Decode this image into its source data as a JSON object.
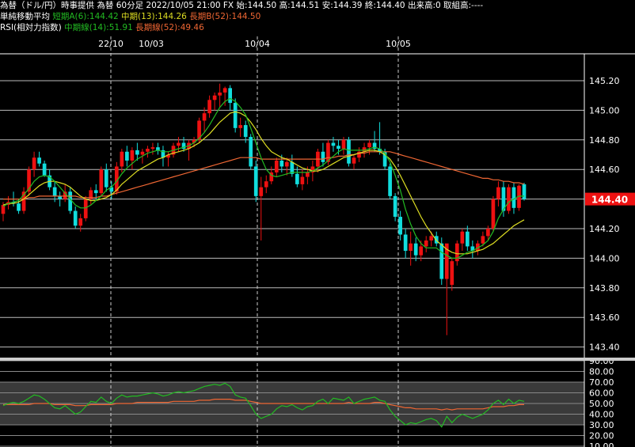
{
  "header": {
    "line1": {
      "title": "為替（ドル/円）時事提供 為替 60分足 2022/10/05 21:00 FX",
      "open": "始:144.50",
      "high": "高:144.51",
      "low": "安:144.39",
      "close": "終:144.40",
      "volume": "出来高:0 取組高:----"
    },
    "line2": {
      "label": "単純移動平均",
      "short": "短期A(6):144.42",
      "mid": "中期(13):144.26",
      "long": "長期B(52):144.50"
    },
    "line3": {
      "label": "RSI(相対力指数)",
      "mid": "中期線(14):51.91",
      "long": "長期線(52):49.46"
    }
  },
  "colors": {
    "up": "#ee1111",
    "down": "#11dddd",
    "ma_short": "#22bb22",
    "ma_mid": "#dddd22",
    "ma_long": "#ee6633",
    "rsi_mid": "#22bb22",
    "rsi_long": "#ee6633",
    "price_tag": "#ee1111"
  },
  "price_tag": "144.40",
  "chart_data": [
    {
      "type": "candlestick",
      "title": "為替（ドル/円）時事提供 為替 60分足",
      "date_labels": [
        "22/10",
        "10/03",
        "10/04",
        "10/05"
      ],
      "ylim": [
        143.3,
        145.3
      ],
      "yticks": [
        "145.20",
        "145.00",
        "144.80",
        "144.60",
        "144.40",
        "144.20",
        "144.00",
        "143.80",
        "143.60",
        "143.40"
      ],
      "candles": [
        [
          144.3,
          144.38,
          144.25,
          144.36
        ],
        [
          144.36,
          144.42,
          144.33,
          144.38
        ],
        [
          144.38,
          144.45,
          144.35,
          144.37
        ],
        [
          144.37,
          144.4,
          144.3,
          144.32
        ],
        [
          144.32,
          144.48,
          144.3,
          144.45
        ],
        [
          144.45,
          144.62,
          144.42,
          144.6
        ],
        [
          144.6,
          144.72,
          144.55,
          144.68
        ],
        [
          144.68,
          144.72,
          144.62,
          144.64
        ],
        [
          144.64,
          144.66,
          144.55,
          144.56
        ],
        [
          144.56,
          144.6,
          144.46,
          144.48
        ],
        [
          144.48,
          144.52,
          144.38,
          144.42
        ],
        [
          144.42,
          144.45,
          144.35,
          144.4
        ],
        [
          144.4,
          144.5,
          144.38,
          144.45
        ],
        [
          144.45,
          144.48,
          144.3,
          144.32
        ],
        [
          144.32,
          144.35,
          144.2,
          144.22
        ],
        [
          144.22,
          144.3,
          144.18,
          144.27
        ],
        [
          144.27,
          144.42,
          144.25,
          144.4
        ],
        [
          144.4,
          144.48,
          144.36,
          144.46
        ],
        [
          144.46,
          144.5,
          144.4,
          144.44
        ],
        [
          144.44,
          144.62,
          144.42,
          144.6
        ],
        [
          144.6,
          144.64,
          144.45,
          144.48
        ],
        [
          144.48,
          144.52,
          144.4,
          144.45
        ],
        [
          144.45,
          144.65,
          144.43,
          144.62
        ],
        [
          144.62,
          144.74,
          144.58,
          144.72
        ],
        [
          144.72,
          144.76,
          144.62,
          144.66
        ],
        [
          144.66,
          144.75,
          144.6,
          144.73
        ],
        [
          144.73,
          144.78,
          144.66,
          144.7
        ],
        [
          144.7,
          144.74,
          144.64,
          144.72
        ],
        [
          144.72,
          144.76,
          144.68,
          144.74
        ],
        [
          144.74,
          144.78,
          144.7,
          144.75
        ],
        [
          144.75,
          144.78,
          144.7,
          144.73
        ],
        [
          144.73,
          144.76,
          144.62,
          144.68
        ],
        [
          144.68,
          144.72,
          144.62,
          144.7
        ],
        [
          144.7,
          144.78,
          144.68,
          144.76
        ],
        [
          144.76,
          144.82,
          144.72,
          144.78
        ],
        [
          144.78,
          144.82,
          144.72,
          144.74
        ],
        [
          144.74,
          144.8,
          144.66,
          144.78
        ],
        [
          144.78,
          144.82,
          144.75,
          144.8
        ],
        [
          144.8,
          144.95,
          144.78,
          144.93
        ],
        [
          144.93,
          145.02,
          144.85,
          144.98
        ],
        [
          144.98,
          145.1,
          144.95,
          145.07
        ],
        [
          145.07,
          145.12,
          145.0,
          145.1
        ],
        [
          145.1,
          145.18,
          145.02,
          145.12
        ],
        [
          145.12,
          145.16,
          145.03,
          145.15
        ],
        [
          145.15,
          145.17,
          145.0,
          145.05
        ],
        [
          145.05,
          145.08,
          144.85,
          144.88
        ],
        [
          144.88,
          144.95,
          144.82,
          144.9
        ],
        [
          144.9,
          144.93,
          144.78,
          144.82
        ],
        [
          144.82,
          144.84,
          144.6,
          144.62
        ],
        [
          144.62,
          144.66,
          144.38,
          144.42
        ],
        [
          144.42,
          144.55,
          144.12,
          144.48
        ],
        [
          144.48,
          144.56,
          144.44,
          144.52
        ],
        [
          144.52,
          144.62,
          144.5,
          144.58
        ],
        [
          144.58,
          144.68,
          144.55,
          144.66
        ],
        [
          144.66,
          144.7,
          144.58,
          144.62
        ],
        [
          144.62,
          144.68,
          144.56,
          144.65
        ],
        [
          144.65,
          144.7,
          144.55,
          144.57
        ],
        [
          144.57,
          144.62,
          144.48,
          144.5
        ],
        [
          144.5,
          144.6,
          144.46,
          144.55
        ],
        [
          144.55,
          144.62,
          144.5,
          144.58
        ],
        [
          144.58,
          144.66,
          144.52,
          144.62
        ],
        [
          144.62,
          144.74,
          144.58,
          144.72
        ],
        [
          144.72,
          144.78,
          144.62,
          144.65
        ],
        [
          144.65,
          144.8,
          144.63,
          144.78
        ],
        [
          144.78,
          144.82,
          144.72,
          144.76
        ],
        [
          144.76,
          144.8,
          144.7,
          144.74
        ],
        [
          144.74,
          144.82,
          144.7,
          144.8
        ],
        [
          144.8,
          144.82,
          144.62,
          144.64
        ],
        [
          144.64,
          144.7,
          144.6,
          144.68
        ],
        [
          144.68,
          144.75,
          144.65,
          144.72
        ],
        [
          144.72,
          144.78,
          144.68,
          144.75
        ],
        [
          144.75,
          144.8,
          144.7,
          144.78
        ],
        [
          144.78,
          144.86,
          144.72,
          144.74
        ],
        [
          144.74,
          144.92,
          144.7,
          144.72
        ],
        [
          144.72,
          144.74,
          144.6,
          144.62
        ],
        [
          144.62,
          144.64,
          144.4,
          144.42
        ],
        [
          144.42,
          144.44,
          144.25,
          144.28
        ],
        [
          144.28,
          144.32,
          144.12,
          144.16
        ],
        [
          144.16,
          144.2,
          144.0,
          144.05
        ],
        [
          144.05,
          144.18,
          143.95,
          144.1
        ],
        [
          144.1,
          144.14,
          143.98,
          144.02
        ],
        [
          144.02,
          144.12,
          143.98,
          144.08
        ],
        [
          144.08,
          144.15,
          144.04,
          144.12
        ],
        [
          144.12,
          144.18,
          144.08,
          144.15
        ],
        [
          144.15,
          144.18,
          144.08,
          144.1
        ],
        [
          144.1,
          144.14,
          143.82,
          143.86
        ],
        [
          143.86,
          143.9,
          143.48,
          144.1
        ],
        [
          143.82,
          144.0,
          143.78,
          143.98
        ],
        [
          143.98,
          144.12,
          143.95,
          144.1
        ],
        [
          144.1,
          144.2,
          144.05,
          144.18
        ],
        [
          144.18,
          144.22,
          144.05,
          144.08
        ],
        [
          144.08,
          144.12,
          144.0,
          144.05
        ],
        [
          144.05,
          144.12,
          144.02,
          144.1
        ],
        [
          144.1,
          144.18,
          144.08,
          144.15
        ],
        [
          144.15,
          144.22,
          144.12,
          144.2
        ],
        [
          144.2,
          144.42,
          144.18,
          144.4
        ],
        [
          144.4,
          144.52,
          144.35,
          144.48
        ],
        [
          144.48,
          144.52,
          144.28,
          144.32
        ],
        [
          144.32,
          144.5,
          144.3,
          144.48
        ],
        [
          144.48,
          144.51,
          144.3,
          144.34
        ],
        [
          144.34,
          144.5,
          144.32,
          144.49
        ],
        [
          144.5,
          144.51,
          144.39,
          144.4
        ]
      ],
      "ma_short": [
        144.35,
        144.37,
        144.38,
        144.39,
        144.43,
        144.47,
        144.52,
        144.55,
        144.56,
        144.55,
        144.52,
        144.48,
        144.44,
        144.4,
        144.36,
        144.34,
        144.34,
        144.36,
        144.39,
        144.42,
        144.46,
        144.48,
        144.52,
        144.57,
        144.61,
        144.64,
        144.67,
        144.69,
        144.71,
        144.72,
        144.73,
        144.72,
        144.72,
        144.73,
        144.74,
        144.75,
        144.76,
        144.78,
        144.81,
        144.85,
        144.9,
        144.96,
        145.02,
        145.06,
        145.08,
        145.06,
        145.02,
        144.97,
        144.88,
        144.78,
        144.68,
        144.6,
        144.56,
        144.55,
        144.56,
        144.57,
        144.58,
        144.58,
        144.58,
        144.58,
        144.59,
        144.61,
        144.63,
        144.66,
        144.69,
        144.72,
        144.74,
        144.73,
        144.73,
        144.73,
        144.73,
        144.74,
        144.75,
        144.74,
        144.71,
        144.65,
        144.56,
        144.46,
        144.33,
        144.23,
        144.15,
        144.1,
        144.07,
        144.07,
        144.07,
        144.04,
        144.02,
        144.0,
        144.0,
        144.02,
        144.04,
        144.05,
        144.07,
        144.09,
        144.12,
        144.18,
        144.27,
        144.33,
        144.38,
        144.4,
        144.42,
        144.42
      ],
      "ma_mid": [
        144.36,
        144.37,
        144.37,
        144.38,
        144.4,
        144.43,
        144.46,
        144.49,
        144.51,
        144.52,
        144.52,
        144.51,
        144.5,
        144.48,
        144.45,
        144.42,
        144.4,
        144.39,
        144.39,
        144.4,
        144.41,
        144.43,
        144.46,
        144.5,
        144.53,
        144.56,
        144.59,
        144.61,
        144.63,
        144.65,
        144.67,
        144.68,
        144.7,
        144.71,
        144.72,
        144.73,
        144.74,
        144.76,
        144.78,
        144.81,
        144.84,
        144.88,
        144.92,
        144.95,
        144.98,
        144.99,
        144.98,
        144.96,
        144.92,
        144.87,
        144.81,
        144.76,
        144.72,
        144.7,
        144.68,
        144.67,
        144.65,
        144.63,
        144.61,
        144.6,
        144.59,
        144.59,
        144.6,
        144.62,
        144.64,
        144.66,
        144.68,
        144.69,
        144.7,
        144.71,
        144.72,
        144.73,
        144.73,
        144.72,
        144.7,
        144.67,
        144.62,
        144.56,
        144.49,
        144.42,
        144.35,
        144.28,
        144.22,
        144.17,
        144.12,
        144.09,
        144.06,
        144.04,
        144.03,
        144.03,
        144.03,
        144.04,
        144.05,
        144.06,
        144.08,
        144.1,
        144.13,
        144.16,
        144.19,
        144.22,
        144.24,
        144.26
      ],
      "ma_long": [
        144.4,
        144.4,
        144.4,
        144.4,
        144.4,
        144.41,
        144.41,
        144.42,
        144.42,
        144.42,
        144.42,
        144.42,
        144.42,
        144.42,
        144.42,
        144.41,
        144.41,
        144.41,
        144.41,
        144.42,
        144.42,
        144.43,
        144.44,
        144.45,
        144.46,
        144.47,
        144.48,
        144.49,
        144.5,
        144.51,
        144.52,
        144.53,
        144.54,
        144.55,
        144.56,
        144.57,
        144.58,
        144.59,
        144.6,
        144.61,
        144.62,
        144.63,
        144.64,
        144.65,
        144.66,
        144.67,
        144.68,
        144.68,
        144.68,
        144.68,
        144.67,
        144.67,
        144.67,
        144.67,
        144.67,
        144.67,
        144.67,
        144.67,
        144.67,
        144.67,
        144.67,
        144.67,
        144.67,
        144.68,
        144.68,
        144.69,
        144.69,
        144.7,
        144.7,
        144.71,
        144.71,
        144.72,
        144.72,
        144.72,
        144.72,
        144.72,
        144.71,
        144.7,
        144.69,
        144.68,
        144.67,
        144.66,
        144.65,
        144.64,
        144.63,
        144.62,
        144.61,
        144.6,
        144.59,
        144.58,
        144.57,
        144.56,
        144.55,
        144.54,
        144.54,
        144.53,
        144.53,
        144.52,
        144.52,
        144.51,
        144.51,
        144.5
      ]
    },
    {
      "type": "line",
      "title": "RSI(相対力指数)",
      "yticks": [
        "90.00",
        "80.00",
        "70.00",
        "60.00",
        "50.00",
        "40.00",
        "30.00",
        "20.00",
        "10.00"
      ],
      "ylim": [
        10,
        90
      ],
      "series": [
        {
          "name": "中期線(14)",
          "values": [
            48,
            50,
            51,
            50,
            52,
            55,
            58,
            57,
            54,
            50,
            46,
            45,
            48,
            44,
            40,
            42,
            47,
            52,
            51,
            56,
            52,
            50,
            55,
            58,
            56,
            57,
            57,
            58,
            59,
            60,
            59,
            57,
            58,
            60,
            61,
            60,
            61,
            62,
            64,
            66,
            67,
            68,
            67,
            69,
            66,
            58,
            56,
            55,
            48,
            40,
            36,
            38,
            40,
            45,
            48,
            47,
            49,
            46,
            44,
            47,
            48,
            52,
            54,
            50,
            55,
            54,
            53,
            56,
            50,
            52,
            54,
            55,
            56,
            53,
            52,
            44,
            38,
            34,
            30,
            32,
            31,
            33,
            35,
            36,
            34,
            28,
            38,
            32,
            37,
            40,
            38,
            36,
            38,
            40,
            44,
            50,
            53,
            49,
            54,
            50,
            53,
            52
          ]
        },
        {
          "name": "長期線(52)",
          "values": [
            49,
            49,
            49,
            49,
            49,
            49,
            50,
            50,
            50,
            50,
            49,
            49,
            49,
            49,
            48,
            48,
            48,
            49,
            49,
            49,
            49,
            49,
            50,
            50,
            50,
            50,
            51,
            51,
            51,
            51,
            51,
            51,
            51,
            52,
            52,
            52,
            52,
            52,
            53,
            53,
            53,
            54,
            54,
            54,
            54,
            53,
            53,
            53,
            52,
            51,
            50,
            50,
            50,
            50,
            50,
            50,
            50,
            50,
            50,
            50,
            50,
            50,
            50,
            50,
            50,
            50,
            50,
            51,
            50,
            50,
            50,
            50,
            51,
            51,
            50,
            49,
            48,
            47,
            46,
            46,
            45,
            45,
            45,
            45,
            45,
            44,
            45,
            44,
            45,
            45,
            45,
            45,
            45,
            45,
            46,
            47,
            47,
            47,
            48,
            48,
            49,
            49
          ]
        }
      ]
    }
  ]
}
